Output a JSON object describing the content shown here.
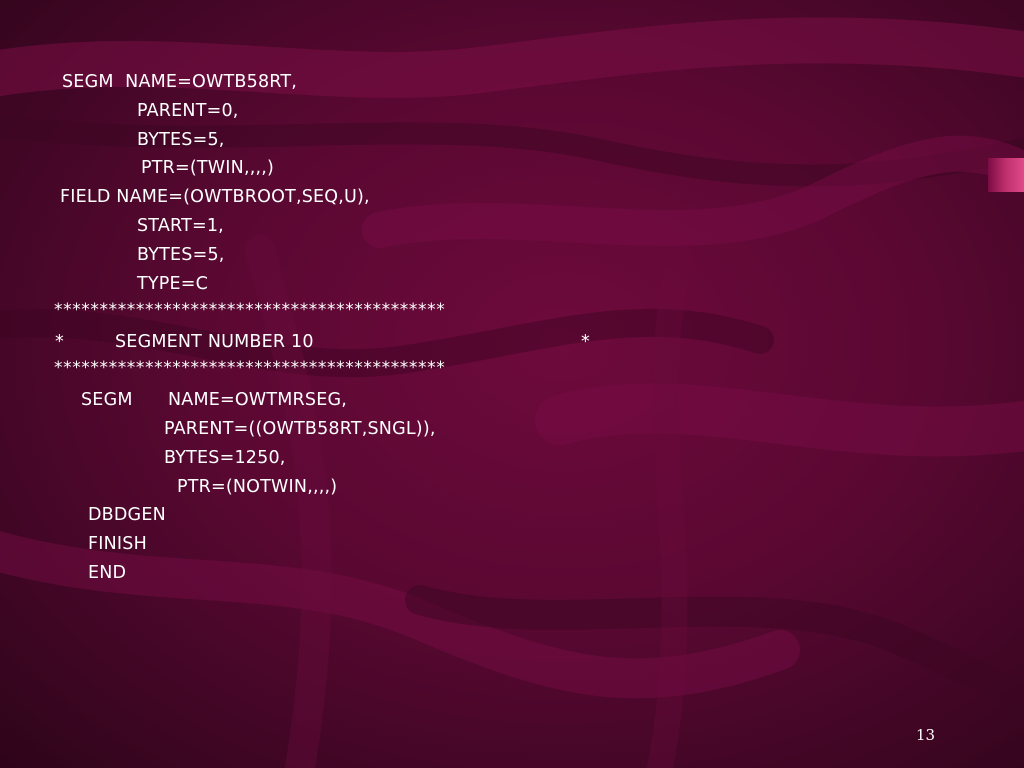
{
  "slide": {
    "lines": [
      "SEGM  NAME=OWTB58RT,",
      "PARENT=0,",
      "BYTES=5,",
      "PTR=(TWIN,,,,)",
      "FIELD NAME=(OWTBROOT,SEQ,U),",
      "START=1,",
      "BYTES=5,",
      "TYPE=C",
      "*******************************************",
      "*",
      "SEGMENT NUMBER 10",
      "*",
      "*******************************************",
      "SEGM",
      "NAME=OWTMRSEG,",
      "PARENT=((OWTB58RT,SNGL)),",
      "BYTES=1250,",
      "PTR=(NOTWIN,,,,)",
      "DBDGEN",
      "FINISH",
      "END"
    ],
    "page_number": "13",
    "colors": {
      "background": "#5a0832",
      "text": "#ffffff",
      "accent": "#e04a8a"
    }
  }
}
